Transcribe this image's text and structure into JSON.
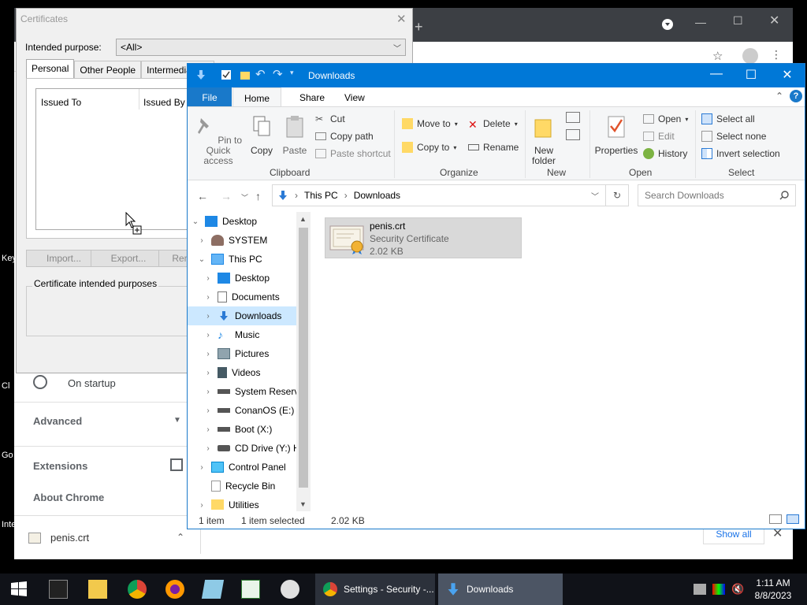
{
  "desktop": {
    "edge_labels": [
      "Key",
      "Cl",
      "Go",
      "Inte"
    ]
  },
  "chrome": {
    "settings_items": {
      "on_startup": "On startup",
      "advanced": "Advanced",
      "extensions": "Extensions",
      "about": "About Chrome"
    },
    "download_shelf": {
      "file_name": "penis.crt",
      "show_all": "Show all"
    }
  },
  "certificates": {
    "title": "Certificates",
    "intended_purpose_label": "Intended purpose:",
    "intended_purpose_value": "<All>",
    "tabs": [
      "Personal",
      "Other People",
      "Intermediate C"
    ],
    "columns": [
      "Issued To",
      "Issued By"
    ],
    "buttons": {
      "import": "Import...",
      "export": "Export...",
      "remove": "Rem"
    },
    "purposes_label": "Certificate intended purposes"
  },
  "explorer": {
    "title": "Downloads",
    "ribbon_tabs": [
      "File",
      "Home",
      "Share",
      "View"
    ],
    "clipboard": {
      "pin": "Pin to Quick access",
      "copy": "Copy",
      "paste": "Paste",
      "cut": "Cut",
      "copy_path": "Copy path",
      "paste_shortcut": "Paste shortcut",
      "group": "Clipboard"
    },
    "organize": {
      "move_to": "Move to",
      "copy_to": "Copy to",
      "delete": "Delete",
      "rename": "Rename",
      "group": "Organize"
    },
    "new": {
      "new_folder": "New folder",
      "group": "New"
    },
    "open": {
      "properties": "Properties",
      "open": "Open",
      "edit": "Edit",
      "history": "History",
      "group": "Open"
    },
    "select": {
      "select_all": "Select all",
      "select_none": "Select none",
      "invert": "Invert selection",
      "group": "Select"
    },
    "address": {
      "crumbs": [
        "This PC",
        "Downloads"
      ]
    },
    "search": {
      "placeholder": "Search Downloads"
    },
    "tree": [
      {
        "label": "Desktop",
        "level": 0,
        "expanded": true
      },
      {
        "label": "SYSTEM",
        "level": 1
      },
      {
        "label": "This PC",
        "level": 1,
        "expanded": true
      },
      {
        "label": "Desktop",
        "level": 2
      },
      {
        "label": "Documents",
        "level": 2
      },
      {
        "label": "Downloads",
        "level": 2,
        "selected": true
      },
      {
        "label": "Music",
        "level": 2
      },
      {
        "label": "Pictures",
        "level": 2
      },
      {
        "label": "Videos",
        "level": 2
      },
      {
        "label": "System Reserve",
        "level": 2
      },
      {
        "label": "ConanOS (E:)",
        "level": 2
      },
      {
        "label": "Boot (X:)",
        "level": 2
      },
      {
        "label": "CD Drive (Y:) H",
        "level": 2
      },
      {
        "label": "Control Panel",
        "level": 1
      },
      {
        "label": "Recycle Bin",
        "level": 1
      },
      {
        "label": "Utilities",
        "level": 1
      }
    ],
    "file": {
      "name": "penis.crt",
      "type": "Security Certificate",
      "size": "2.02 KB"
    },
    "status": {
      "count": "1 item",
      "selected": "1 item selected",
      "size": "2.02 KB"
    }
  },
  "taskbar": {
    "tasks": [
      {
        "label": "Settings - Security -..."
      },
      {
        "label": "Downloads"
      }
    ],
    "clock": {
      "time": "1:11 AM",
      "date": "8/8/2023"
    }
  },
  "colors": {
    "explorer_accent": "#0078d7",
    "taskbar": "#101218",
    "selection": "#cce8ff"
  }
}
